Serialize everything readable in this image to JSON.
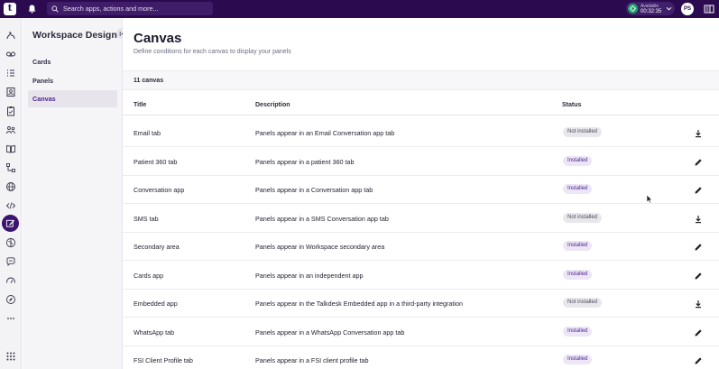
{
  "topbar": {
    "logo_letter": "t",
    "search_placeholder": "Search apps, actions and more...",
    "status_label": "Available",
    "status_time": "00:32:35",
    "avatar_initials": "PS"
  },
  "rail": {
    "icons": [
      "routing-icon",
      "voicemail-icon",
      "list-icon",
      "contact-card-icon",
      "clipboard-icon",
      "people-icon",
      "book-icon",
      "flow-icon",
      "globe-icon",
      "code-icon",
      "edit-square-icon",
      "brain-icon",
      "chat-icon",
      "gauge-icon",
      "compass-icon",
      "more-icon",
      "apps-grid-icon"
    ],
    "active_index": 10
  },
  "subnav": {
    "title": "Workspace Designer",
    "items": [
      {
        "label": "Cards",
        "active": false
      },
      {
        "label": "Panels",
        "active": false
      },
      {
        "label": "Canvas",
        "active": true
      }
    ]
  },
  "main": {
    "title": "Canvas",
    "subtitle": "Define conditions for each canvas to display your panels",
    "count_label": "11 canvas",
    "columns": {
      "title": "Title",
      "description": "Description",
      "status": "Status"
    },
    "rows": [
      {
        "title": "Email tab",
        "description": "Panels appear in an Email Conversation app tab",
        "status": "Not installed",
        "action": "download"
      },
      {
        "title": "Patient 360 tab",
        "description": "Panels appear in a patient 360 tab",
        "status": "Installed",
        "action": "edit"
      },
      {
        "title": "Conversation app",
        "description": "Panels appear in a Conversation app tab",
        "status": "Installed",
        "action": "edit"
      },
      {
        "title": "SMS tab",
        "description": "Panels appear in a SMS Conversation app tab",
        "status": "Not installed",
        "action": "download"
      },
      {
        "title": "Secondary area",
        "description": "Panels appear in Workspace secondary area",
        "status": "Installed",
        "action": "edit"
      },
      {
        "title": "Cards app",
        "description": "Panels appear in an independent app",
        "status": "Installed",
        "action": "edit"
      },
      {
        "title": "Embedded app",
        "description": "Panels appear in the Talkdesk Embedded app in a third-party integration",
        "status": "Not installed",
        "action": "download"
      },
      {
        "title": "WhatsApp tab",
        "description": "Panels appear in a WhatsApp Conversation app tab",
        "status": "Installed",
        "action": "edit"
      },
      {
        "title": "FSI Client Profile tab",
        "description": "Panels appear in a FSI client profile tab",
        "status": "Installed",
        "action": "edit"
      }
    ]
  },
  "colors": {
    "brand": "#2b0a4f",
    "accent": "#4b1e8c",
    "available": "#23a26d"
  }
}
